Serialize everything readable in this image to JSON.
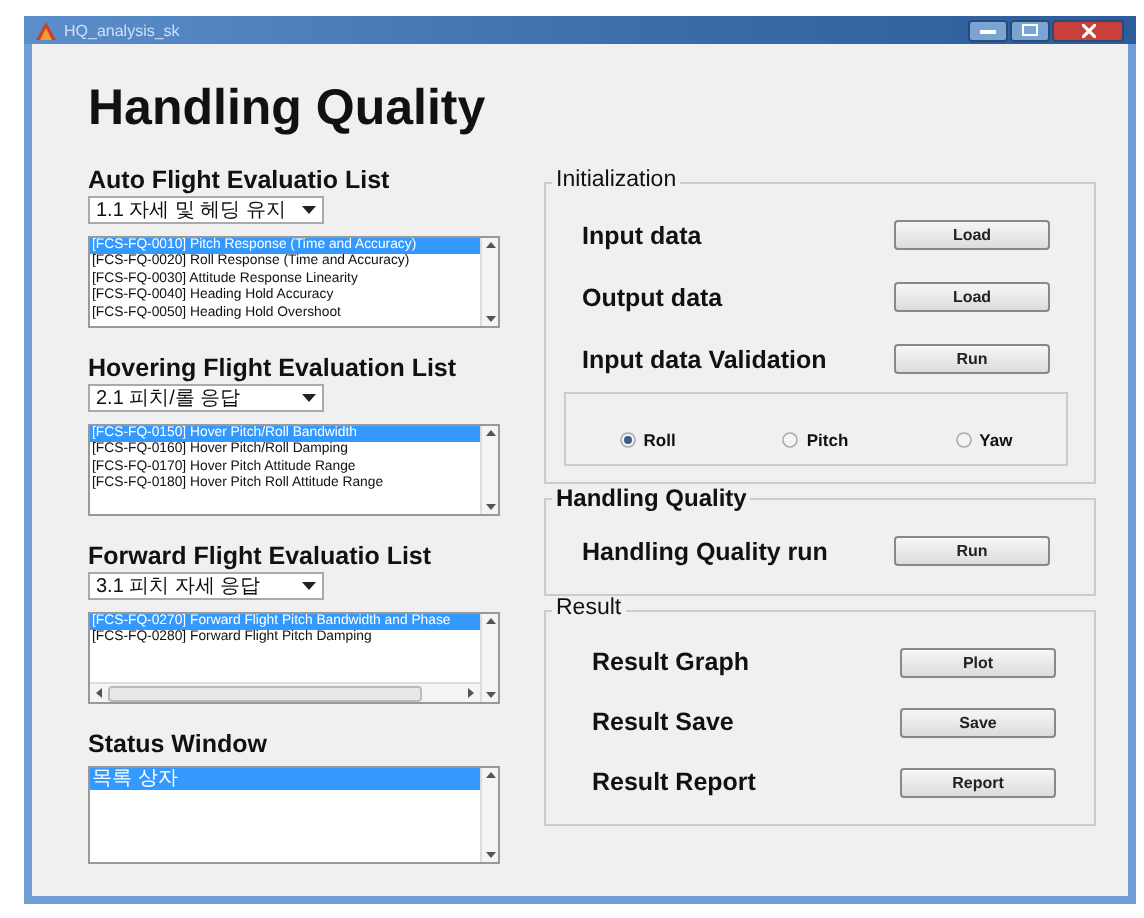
{
  "window": {
    "title": "HQ_analysis_sk"
  },
  "heading": "Handling Quality",
  "lists": [
    {
      "title": "Auto Flight Evaluatio List",
      "dropdown": "1.1 자세 및 헤딩 유지",
      "items": [
        {
          "text": "[FCS-FQ-0010] Pitch Response (Time and Accuracy)",
          "selected": true
        },
        {
          "text": "[FCS-FQ-0020] Roll Response (Time and Accuracy)",
          "selected": false
        },
        {
          "text": "[FCS-FQ-0030] Attitude Response Linearity",
          "selected": false
        },
        {
          "text": "[FCS-FQ-0040] Heading Hold Accuracy",
          "selected": false
        },
        {
          "text": "[FCS-FQ-0050] Heading Hold Overshoot",
          "selected": false
        }
      ]
    },
    {
      "title": "Hovering Flight Evaluation List",
      "dropdown": "2.1 피치/롤 응답",
      "items": [
        {
          "text": "[FCS-FQ-0150] Hover Pitch/Roll Bandwidth",
          "selected": true
        },
        {
          "text": "[FCS-FQ-0160] Hover Pitch/Roll Damping",
          "selected": false
        },
        {
          "text": "[FCS-FQ-0170] Hover Pitch Attitude Range",
          "selected": false
        },
        {
          "text": "[FCS-FQ-0180] Hover Pitch Roll Attitude Range",
          "selected": false
        }
      ]
    },
    {
      "title": "Forward Flight Evaluatio List",
      "dropdown": "3.1 피치 자세 응답",
      "hscroll": true,
      "items": [
        {
          "text": "[FCS-FQ-0270] Forward Flight Pitch Bandwidth and Phase",
          "selected": true
        },
        {
          "text": "[FCS-FQ-0280] Forward Flight Pitch Damping",
          "selected": false
        }
      ]
    },
    {
      "title": "Status Window",
      "items": [
        {
          "text": "목록 상자",
          "selected": true
        }
      ]
    }
  ],
  "groups": [
    {
      "title": "Initialization",
      "rows": [
        {
          "label": "Input data",
          "button": "Load"
        },
        {
          "label": "Output data",
          "button": "Load"
        },
        {
          "label": "Input data Validation",
          "button": "Run"
        }
      ],
      "radios": [
        {
          "label": "Roll",
          "selected": true
        },
        {
          "label": "Pitch",
          "selected": false
        },
        {
          "label": "Yaw",
          "selected": false
        }
      ]
    },
    {
      "title": "Handling Quality",
      "rows": [
        {
          "label": "Handling Quality run",
          "button": "Run"
        }
      ]
    },
    {
      "title": "Result",
      "rows": [
        {
          "label": "Result Graph",
          "button": "Plot"
        },
        {
          "label": "Result Save",
          "button": "Save"
        },
        {
          "label": "Result Report",
          "button": "Report"
        }
      ]
    }
  ]
}
